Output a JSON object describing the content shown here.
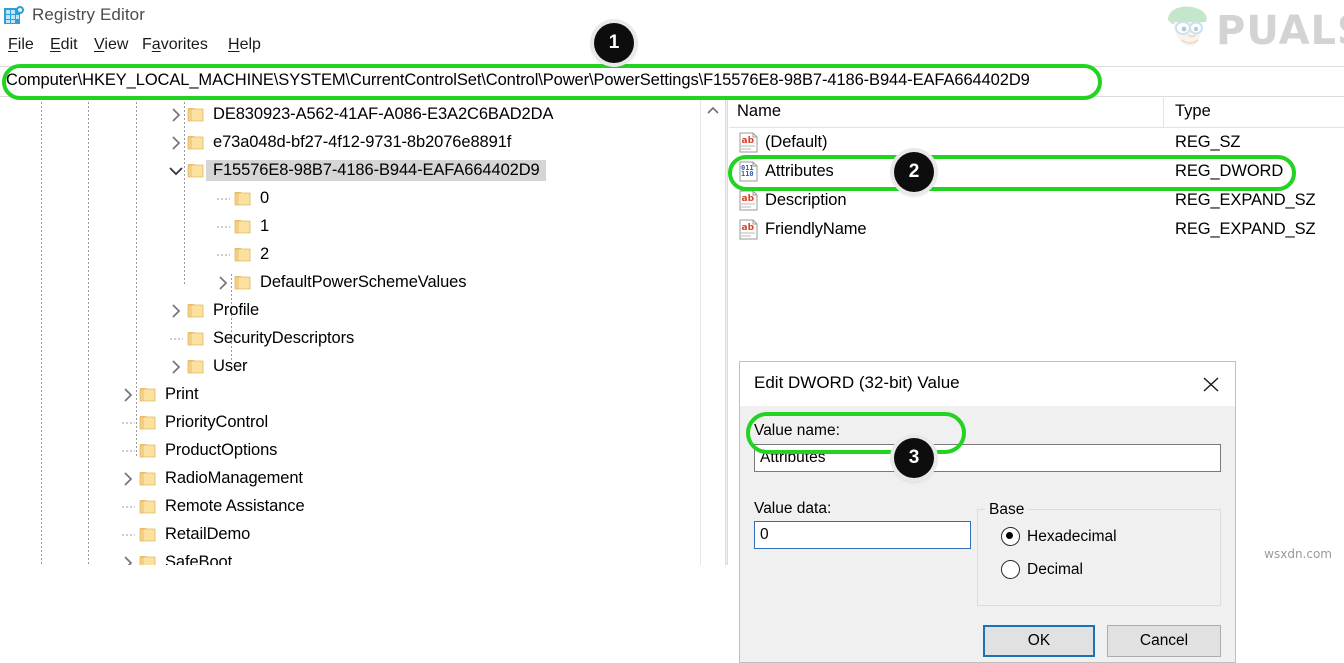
{
  "window": {
    "title": "Registry Editor",
    "icon": "registry-editor-icon"
  },
  "menubar": {
    "items": [
      {
        "label": "File",
        "accesskey": "F"
      },
      {
        "label": "Edit",
        "accesskey": "E"
      },
      {
        "label": "View",
        "accesskey": "V"
      },
      {
        "label": "Favorites",
        "accesskey": "a"
      },
      {
        "label": "Help",
        "accesskey": "H"
      }
    ]
  },
  "address_bar": {
    "path": "Computer\\HKEY_LOCAL_MACHINE\\SYSTEM\\CurrentControlSet\\Control\\Power\\PowerSettings\\F15576E8-98B7-4186-B944-EAFA664402D9"
  },
  "tree": {
    "items": [
      {
        "label": "DE830923-A562-41AF-A086-E3A2C6BAD2DA",
        "depth": 4,
        "expander": "collapsed",
        "selected": false
      },
      {
        "label": "e73a048d-bf27-4f12-9731-8b2076e8891f",
        "depth": 4,
        "expander": "collapsed",
        "selected": false
      },
      {
        "label": "F15576E8-98B7-4186-B944-EAFA664402D9",
        "depth": 4,
        "expander": "expanded",
        "selected": true
      },
      {
        "label": "0",
        "depth": 5,
        "expander": "none",
        "selected": false
      },
      {
        "label": "1",
        "depth": 5,
        "expander": "none",
        "selected": false
      },
      {
        "label": "2",
        "depth": 5,
        "expander": "none",
        "selected": false
      },
      {
        "label": "DefaultPowerSchemeValues",
        "depth": 5,
        "expander": "collapsed",
        "selected": false
      },
      {
        "label": "Profile",
        "depth": 4,
        "expander": "collapsed",
        "selected": false
      },
      {
        "label": "SecurityDescriptors",
        "depth": 4,
        "expander": "none",
        "selected": false
      },
      {
        "label": "User",
        "depth": 4,
        "expander": "collapsed",
        "selected": false
      },
      {
        "label": "Print",
        "depth": 3,
        "expander": "collapsed",
        "selected": false
      },
      {
        "label": "PriorityControl",
        "depth": 3,
        "expander": "none",
        "selected": false
      },
      {
        "label": "ProductOptions",
        "depth": 3,
        "expander": "none",
        "selected": false
      },
      {
        "label": "RadioManagement",
        "depth": 3,
        "expander": "collapsed",
        "selected": false
      },
      {
        "label": "Remote Assistance",
        "depth": 3,
        "expander": "none",
        "selected": false
      },
      {
        "label": "RetailDemo",
        "depth": 3,
        "expander": "none",
        "selected": false
      },
      {
        "label": "SafeBoot",
        "depth": 3,
        "expander": "collapsed",
        "selected": false
      }
    ]
  },
  "values_list": {
    "columns": [
      "Name",
      "Type"
    ],
    "rows": [
      {
        "name": "(Default)",
        "type": "REG_SZ",
        "icon": "string-value-icon"
      },
      {
        "name": "Attributes",
        "type": "REG_DWORD",
        "icon": "dword-value-icon"
      },
      {
        "name": "Description",
        "type": "REG_EXPAND_SZ",
        "icon": "string-value-icon"
      },
      {
        "name": "FriendlyName",
        "type": "REG_EXPAND_SZ",
        "icon": "string-value-icon"
      }
    ]
  },
  "dialog": {
    "title": "Edit DWORD (32-bit) Value",
    "close_label": "✕",
    "value_name_label": "Value name:",
    "value_name": "Attributes",
    "value_data_label": "Value data:",
    "value_data": "0",
    "base_group_label": "Base",
    "base_options": [
      {
        "label": "Hexadecimal",
        "selected": true
      },
      {
        "label": "Decimal",
        "selected": false
      }
    ],
    "ok_label": "OK",
    "cancel_label": "Cancel"
  },
  "annotations": {
    "badges": [
      {
        "number": "1",
        "target": "address-bar"
      },
      {
        "number": "2",
        "target": "attributes-row"
      },
      {
        "number": "3",
        "target": "value-data-field"
      }
    ],
    "highlight_color": "#22d321"
  },
  "watermarks": {
    "brand": "PUALS",
    "source": "wsxdn.com"
  }
}
